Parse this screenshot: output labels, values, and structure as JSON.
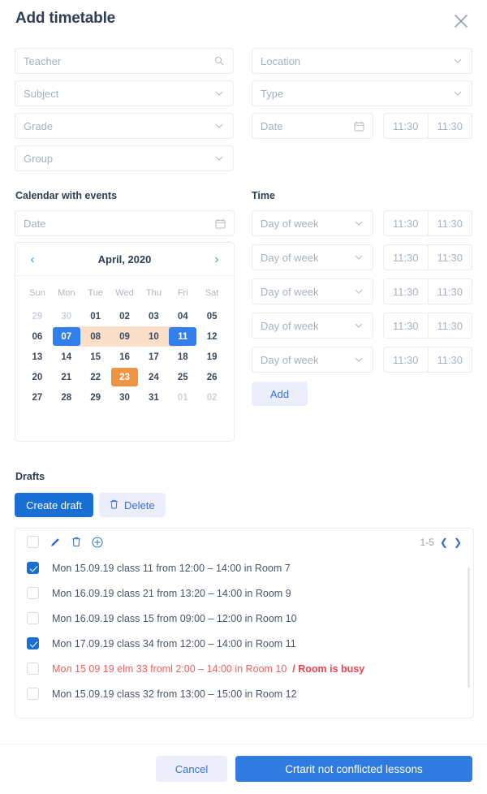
{
  "header": {
    "title": "Add timetable",
    "close_icon": "close-icon"
  },
  "form": {
    "teacher": {
      "placeholder": "Teacher",
      "icon": "search-icon"
    },
    "subject": {
      "placeholder": "Subject",
      "icon": "chevron-down-icon"
    },
    "grade": {
      "placeholder": "Grade",
      "icon": "chevron-down-icon"
    },
    "group": {
      "placeholder": "Group",
      "icon": "chevron-down-icon"
    },
    "location": {
      "placeholder": "Location",
      "icon": "chevron-down-icon"
    },
    "type": {
      "placeholder": "Type",
      "icon": "chevron-down-icon"
    },
    "date": {
      "placeholder": "Date",
      "icon": "calendar-icon"
    },
    "time_from": "11:30",
    "time_to": "11:30"
  },
  "calendar_section": {
    "label": "Calendar with events",
    "date_field": {
      "placeholder": "Date",
      "icon": "calendar-icon"
    },
    "month_title": "April, 2020",
    "prev_icon": "chevron-left-icon",
    "next_icon": "chevron-right-icon",
    "dows": [
      "Sun",
      "Mon",
      "Tue",
      "Wed",
      "Thu",
      "Fri",
      "Sat"
    ],
    "weeks": [
      [
        {
          "d": "29",
          "s": "muted"
        },
        {
          "d": "30",
          "s": "muted"
        },
        {
          "d": "01",
          "s": ""
        },
        {
          "d": "02",
          "s": ""
        },
        {
          "d": "03",
          "s": ""
        },
        {
          "d": "04",
          "s": ""
        },
        {
          "d": "05",
          "s": ""
        }
      ],
      [
        {
          "d": "06",
          "s": ""
        },
        {
          "d": "07",
          "s": "sel range-start"
        },
        {
          "d": "08",
          "s": "inrange"
        },
        {
          "d": "09",
          "s": "inrange"
        },
        {
          "d": "10",
          "s": "inrange"
        },
        {
          "d": "11",
          "s": "sel range-end"
        },
        {
          "d": "12",
          "s": ""
        }
      ],
      [
        {
          "d": "13",
          "s": ""
        },
        {
          "d": "14",
          "s": ""
        },
        {
          "d": "15",
          "s": ""
        },
        {
          "d": "16",
          "s": ""
        },
        {
          "d": "17",
          "s": ""
        },
        {
          "d": "18",
          "s": ""
        },
        {
          "d": "19",
          "s": ""
        }
      ],
      [
        {
          "d": "20",
          "s": ""
        },
        {
          "d": "21",
          "s": ""
        },
        {
          "d": "22",
          "s": ""
        },
        {
          "d": "23",
          "s": "evt"
        },
        {
          "d": "24",
          "s": ""
        },
        {
          "d": "25",
          "s": ""
        },
        {
          "d": "26",
          "s": ""
        }
      ],
      [
        {
          "d": "27",
          "s": ""
        },
        {
          "d": "28",
          "s": ""
        },
        {
          "d": "29",
          "s": ""
        },
        {
          "d": "30",
          "s": ""
        },
        {
          "d": "31",
          "s": ""
        },
        {
          "d": "01",
          "s": "muted"
        },
        {
          "d": "02",
          "s": "muted"
        }
      ]
    ]
  },
  "time_section": {
    "label": "Time",
    "rows": [
      {
        "day_placeholder": "Day of week",
        "from": "11:30",
        "to": "11:30"
      },
      {
        "day_placeholder": "Day of week",
        "from": "11:30",
        "to": "11:30"
      },
      {
        "day_placeholder": "Day of week",
        "from": "11:30",
        "to": "11:30"
      },
      {
        "day_placeholder": "Day of week",
        "from": "11:30",
        "to": "11:30"
      },
      {
        "day_placeholder": "Day of week",
        "from": "11:30",
        "to": "11:30"
      }
    ],
    "add_label": "Add"
  },
  "drafts": {
    "label": "Drafts",
    "create_label": "Create draft",
    "delete_label": "Delete",
    "delete_icon": "trash-icon",
    "toolbar": {
      "select_all_checked": false,
      "edit_icon": "pencil-icon",
      "trash_icon": "trash-icon",
      "add_icon": "plus-circle-icon"
    },
    "pager": {
      "range": "1-5",
      "prev_icon": "chevron-left-icon",
      "next_icon": "chevron-right-icon"
    },
    "rows": [
      {
        "checked": true,
        "text": "Mon 15.09.19 class 11 from 12:00 – 14:00 in Room 7",
        "error": false,
        "badge": ""
      },
      {
        "checked": false,
        "text": "Mon 16.09.19 class 21 from 13:20 – 14:00 in Room 9",
        "error": false,
        "badge": ""
      },
      {
        "checked": false,
        "text": "Mon 16.09.19 class 15 from 09:00 – 12:00 in Room 10",
        "error": false,
        "badge": ""
      },
      {
        "checked": true,
        "text": "Mon 17.09.19 class 34 from 12:00 – 14:00 in Room 11",
        "error": false,
        "badge": ""
      },
      {
        "checked": false,
        "text": "Мол 15 09 19 elm 33 froml 2:00 – 14:00 in Room 10",
        "error": true,
        "badge": "/ Room is busy"
      },
      {
        "checked": false,
        "text": "Mon 15.09.19 class 32 from 13:00 – 15:00 in Room 12",
        "error": false,
        "badge": ""
      }
    ]
  },
  "footer": {
    "cancel_label": "Cancel",
    "create_label": "Crtarit not conflicted lessons"
  },
  "colors": {
    "primary": "#1a6fd4",
    "accent_soft": "#eceffb",
    "range": "#fbdfc9",
    "event": "#ef9344",
    "error": "#f2605f"
  }
}
